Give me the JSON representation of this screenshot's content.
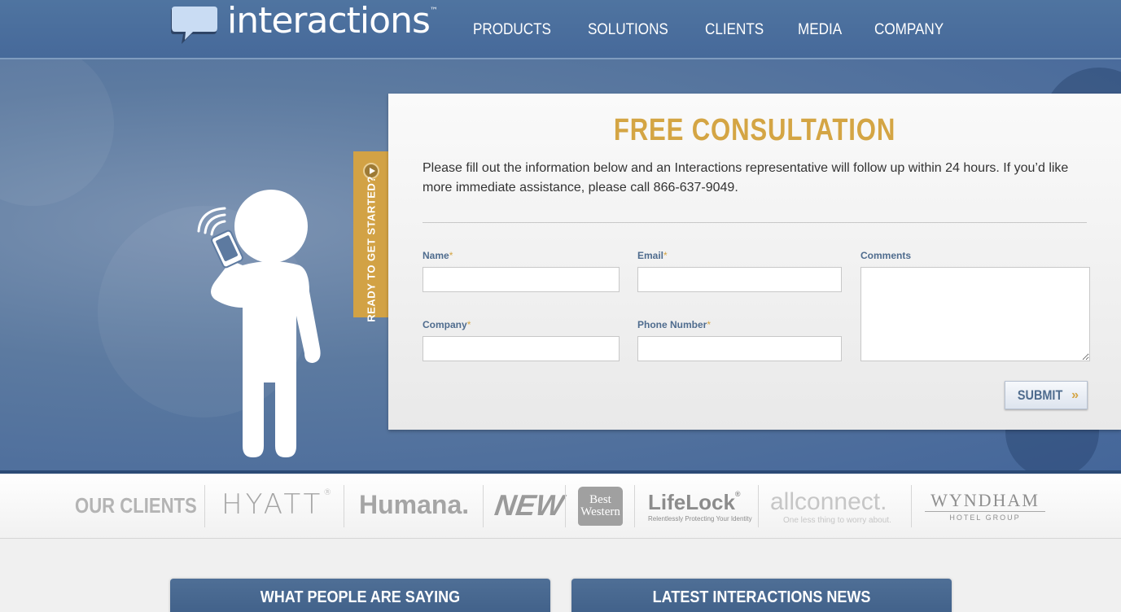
{
  "header": {
    "logo_text": "interactions",
    "logo_tm": "™",
    "nav": [
      "PRODUCTS",
      "SOLUTIONS",
      "CLIENTS",
      "MEDIA",
      "COMPANY"
    ]
  },
  "hero": {
    "tab_label": "READY TO GET STARTED?"
  },
  "form": {
    "title": "FREE CONSULTATION",
    "intro": "Please fill out the information below and an Interactions representative will follow up within 24 hours. If you’d like more immediate assistance, please call 866-637-9049.",
    "required_mark": "*",
    "fields": {
      "name": {
        "label": "Name",
        "value": ""
      },
      "email": {
        "label": "Email",
        "value": ""
      },
      "comments": {
        "label": "Comments",
        "value": ""
      },
      "company": {
        "label": "Company",
        "value": ""
      },
      "phone": {
        "label": "Phone Number",
        "value": ""
      }
    },
    "submit_label": "SUBMIT",
    "submit_arrow": "»"
  },
  "clients": {
    "title": "OUR CLIENTS",
    "logos": {
      "hyatt": "HYATT",
      "hyatt_mark": "®",
      "humana": "Humana.",
      "new": "NEW",
      "best_western_1": "Best",
      "best_western_2": "Western",
      "lifelock": "LifeLock",
      "lifelock_mark": "®",
      "lifelock_tagline": "Relentlessly Protecting Your Identity",
      "allconnect": "allconnect.",
      "allconnect_tagline": "One less thing to worry about.",
      "wyndham": "WYNDHAM",
      "wyndham_sub": "HOTEL GROUP"
    }
  },
  "boxes": {
    "left_title": "WHAT PEOPLE ARE SAYING",
    "right_title": "LATEST INTERACTIONS NEWS"
  },
  "colors": {
    "header_blue": "#4f74a0",
    "accent_gold": "#d4a544",
    "label_blue": "#4f6c8e"
  }
}
